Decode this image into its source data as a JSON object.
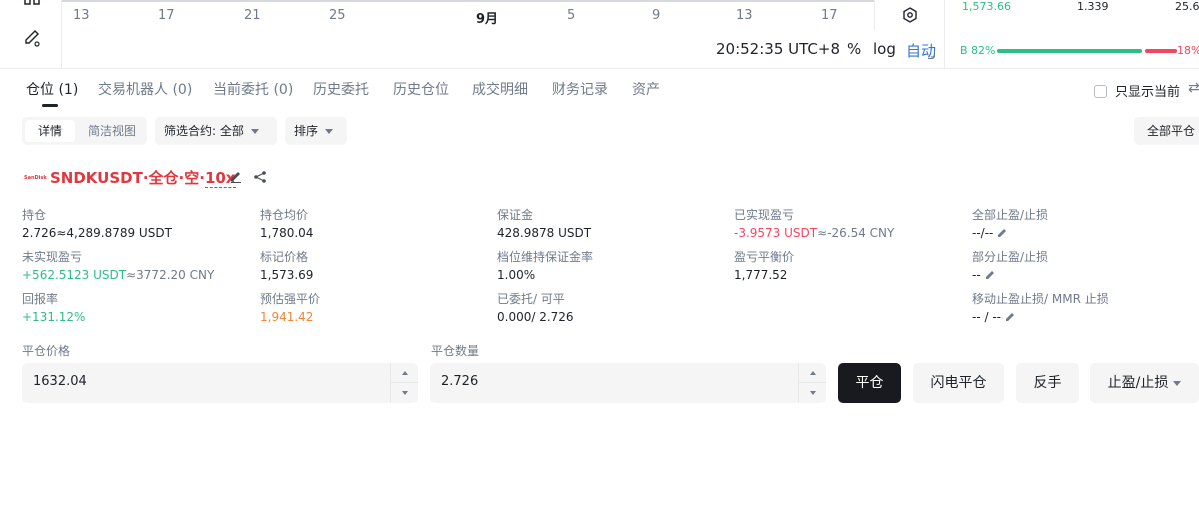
{
  "chart": {
    "x_ticks": [
      {
        "label": "13",
        "bold": false
      },
      {
        "label": "17",
        "bold": false
      },
      {
        "label": "21",
        "bold": false
      },
      {
        "label": "25",
        "bold": false
      },
      {
        "label": "9月",
        "bold": true
      },
      {
        "label": "5",
        "bold": false
      },
      {
        "label": "9",
        "bold": false
      },
      {
        "label": "13",
        "bold": false
      },
      {
        "label": "17",
        "bold": false
      }
    ],
    "clock": "20:52:35 UTC+8",
    "pct_label": "%",
    "log_label": "log",
    "auto_label": "自动"
  },
  "orderbook": {
    "price": "1,573.66",
    "qty": "1.339",
    "total": "25.6",
    "buy_label": "B 82%",
    "sell_label": "18%",
    "buy_ratio": 0.82
  },
  "tabs": [
    {
      "label": "仓位 (1)",
      "active": true
    },
    {
      "label": "交易机器人 (0)",
      "active": false
    },
    {
      "label": "当前委托 (0)",
      "active": false
    },
    {
      "label": "历史委托",
      "active": false
    },
    {
      "label": "历史仓位",
      "active": false
    },
    {
      "label": "成交明细",
      "active": false
    },
    {
      "label": "财务记录",
      "active": false
    },
    {
      "label": "资产",
      "active": false
    }
  ],
  "only_current_label": "只显示当前",
  "filters": {
    "view_detail": "详情",
    "view_simple": "简洁视图",
    "contract_filter": "筛选合约:  全部",
    "sort": "排序",
    "close_all": "全部平仓"
  },
  "position": {
    "logo_text": "SanDisk",
    "title_main": "SNDKUSDT·全仓·空·",
    "leverage": "10x",
    "stats": [
      {
        "label": "持仓",
        "value": "2.726≈4,289.8789 USDT",
        "tone": ""
      },
      {
        "label": "持仓均价",
        "value": "1,780.04",
        "tone": ""
      },
      {
        "label": "保证金",
        "value": "428.9878 USDT",
        "tone": ""
      },
      {
        "label": "已实现盈亏",
        "value": "-3.9573 USDT≈-26.54 CNY",
        "tone": "red-mixed"
      },
      {
        "label": "全部止盈/止损",
        "value": "--/--",
        "tone": "tpsl"
      },
      {
        "label": "未实现盈亏",
        "value": "+562.5123 USDT≈3772.20 CNY",
        "tone": "green-mixed"
      },
      {
        "label": "标记价格",
        "value": "1,573.69",
        "tone": ""
      },
      {
        "label": "档位维持保证金率",
        "value": "1.00%",
        "tone": ""
      },
      {
        "label": "盈亏平衡价",
        "value": "1,777.52",
        "tone": ""
      },
      {
        "label": "部分止盈/止损",
        "value": "--",
        "tone": "edit"
      },
      {
        "label": "回报率",
        "value": "+131.12%",
        "tone": "green"
      },
      {
        "label": "预估强平价",
        "value": "1,941.42",
        "tone": "orange"
      },
      {
        "label": "已委托/ 可平",
        "value": "0.000/ 2.726",
        "tone": ""
      },
      {
        "label": "",
        "value": "",
        "tone": ""
      },
      {
        "label": "移动止盈止损/ MMR 止损",
        "value": "-- / --",
        "tone": "edit2"
      }
    ]
  },
  "close_form": {
    "price_label": "平仓价格",
    "price_value": "1632.04",
    "qty_label": "平仓数量",
    "qty_value": "2.726",
    "close_btn": "平仓",
    "flash_close_btn": "闪电平仓",
    "reverse_btn": "反手",
    "tpsl_btn": "止盈/止损"
  },
  "colors": {
    "up": "#2ebd85",
    "down": "#f6465d",
    "accent": "#3375e0",
    "liq": "#f0873c"
  }
}
